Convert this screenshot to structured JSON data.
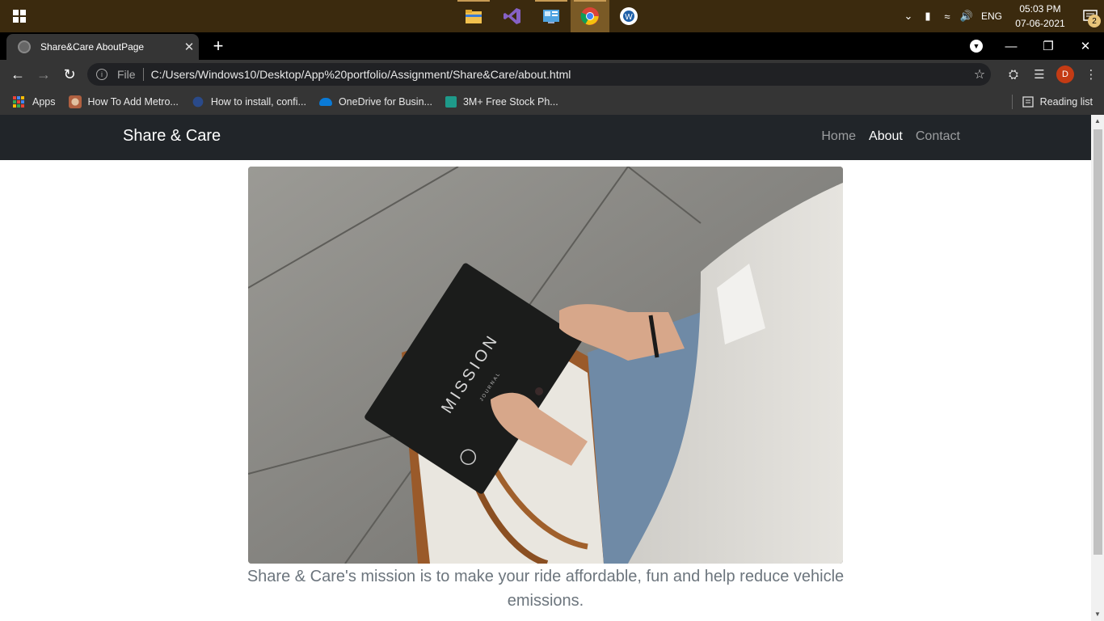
{
  "taskbar": {
    "apps": [
      {
        "name": "File Explorer",
        "icon": "folder-icon"
      },
      {
        "name": "Visual Studio",
        "icon": "visual-studio-icon"
      },
      {
        "name": "Control Panel",
        "icon": "control-panel-icon"
      },
      {
        "name": "Google Chrome",
        "icon": "chrome-icon"
      },
      {
        "name": "App",
        "icon": "app-icon"
      }
    ],
    "language": "ENG",
    "time": "05:03 PM",
    "date": "07-06-2021",
    "notification_count": "2"
  },
  "browser": {
    "tab_title": "Share&Care AboutPage",
    "url_scheme": "File",
    "url": "C:/Users/Windows10/Desktop/App%20portfolio/Assignment/Share&Care/about.html",
    "profile_initial": "D",
    "bookmarks": [
      {
        "label": "Apps"
      },
      {
        "label": "How To Add Metro..."
      },
      {
        "label": "How to install, confi..."
      },
      {
        "label": "OneDrive for Busin..."
      },
      {
        "label": "3M+ Free Stock Ph..."
      }
    ],
    "reading_list": "Reading list"
  },
  "site": {
    "brand": "Share & Care",
    "nav": [
      {
        "label": "Home",
        "active": false
      },
      {
        "label": "About",
        "active": true
      },
      {
        "label": "Contact",
        "active": false
      }
    ],
    "journal_text": "MISSION",
    "journal_subtext": "JOURNAL",
    "mission_text": "Share & Care's mission is to make your ride affordable, fun and help reduce vehicle emissions."
  },
  "colors": {
    "taskbar": "#3b2a0e",
    "navbar": "#212529",
    "muted_text": "#6c757d",
    "avatar": "#c43b14"
  }
}
